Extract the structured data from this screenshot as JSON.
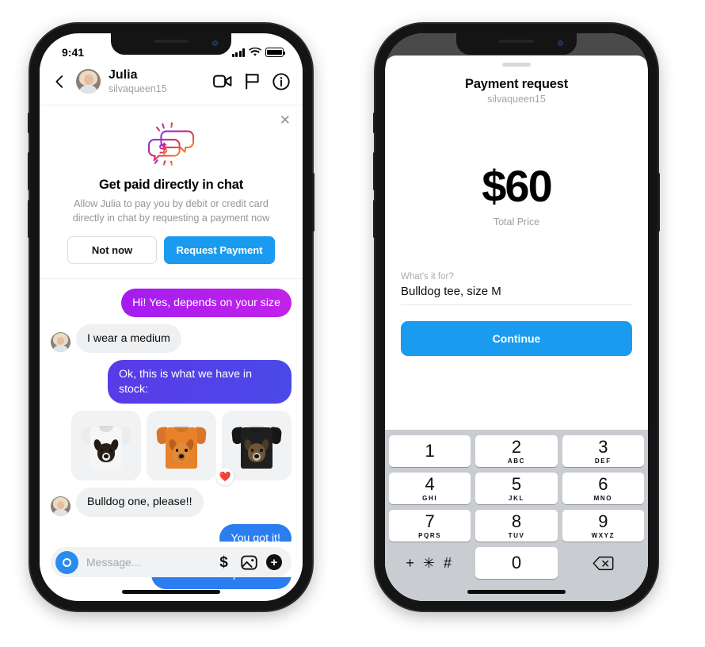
{
  "left_phone": {
    "status_bar": {
      "time": "9:41",
      "signal_icon": "cellular-bars-icon",
      "wifi_icon": "wifi-icon",
      "battery_icon": "battery-full-icon"
    },
    "chat_header": {
      "back_icon": "back-chevron-icon",
      "avatar_icon": "user-avatar",
      "name": "Julia",
      "username": "silvaqueen15",
      "video_icon": "video-camera-icon",
      "flag_icon": "flag-icon",
      "info_icon": "info-circle-icon"
    },
    "promo": {
      "close_icon": "close-x-icon",
      "art_icon": "chat-bubbles-dollar-icon",
      "title": "Get paid directly in chat",
      "subtitle": "Allow Julia to pay you by debit or credit card directly in chat by requesting a payment now",
      "secondary_label": "Not now",
      "primary_label": "Request Payment"
    },
    "messages": [
      {
        "side": "out",
        "text": "Hi! Yes, depends on your size",
        "color": "#b01df0"
      },
      {
        "side": "in",
        "text": "I wear a medium"
      },
      {
        "side": "out",
        "text": "Ok, this is what we have in stock:",
        "color": "#4f46e5"
      }
    ],
    "products": {
      "items": [
        {
          "name": "border-collie-white-tee",
          "shirt_color": "#f4f4f4",
          "dog": "border collie"
        },
        {
          "name": "golden-retriever-orange-tee",
          "shirt_color": "#e8822a",
          "dog": "golden retriever"
        },
        {
          "name": "bulldog-black-tee",
          "shirt_color": "#201f1f",
          "dog": "bulldog"
        }
      ],
      "reaction_emoji": "❤️"
    },
    "messages_tail": [
      {
        "side": "in",
        "text": "Bulldog one, please!!"
      },
      {
        "side": "out",
        "text": "You got it!",
        "color": "#2b7ef0"
      },
      {
        "side": "out",
        "text": "I'll create a request now",
        "color": "#2b7ef0"
      }
    ],
    "composer": {
      "camera_icon": "camera-icon",
      "placeholder": "Message...",
      "dollar_icon": "dollar-icon",
      "image_icon": "image-icon",
      "plus_icon": "plus-icon"
    }
  },
  "right_phone": {
    "sheet": {
      "grabber_icon": "drag-handle-icon",
      "title": "Payment request",
      "username": "silvaqueen15",
      "amount": "$60",
      "amount_label": "Total Price",
      "field_label": "What's it for?",
      "field_value": "Bulldog tee, size M",
      "continue_label": "Continue"
    },
    "keypad": {
      "keys": [
        {
          "digit": "1",
          "letters": ""
        },
        {
          "digit": "2",
          "letters": "ABC"
        },
        {
          "digit": "3",
          "letters": "DEF"
        },
        {
          "digit": "4",
          "letters": "GHI"
        },
        {
          "digit": "5",
          "letters": "JKL"
        },
        {
          "digit": "6",
          "letters": "MNO"
        },
        {
          "digit": "7",
          "letters": "PQRS"
        },
        {
          "digit": "8",
          "letters": "TUV"
        },
        {
          "digit": "9",
          "letters": "WXYZ"
        }
      ],
      "symbols_label": "+ ✳ #",
      "zero": "0",
      "delete_icon": "backspace-icon"
    }
  },
  "theme": {
    "accent_blue": "#1a9bf0",
    "message_blue": "#2b7ef0",
    "message_purple": "#b01df0",
    "message_violet": "#4f46e5",
    "grey_bubble": "#eef0f2"
  }
}
